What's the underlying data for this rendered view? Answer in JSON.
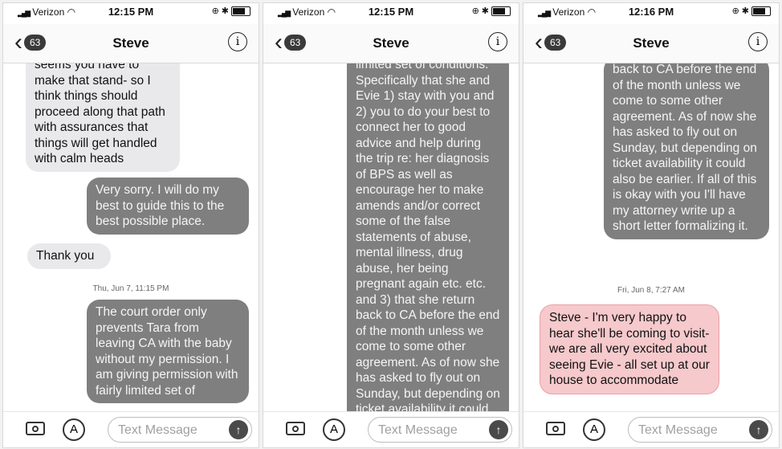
{
  "panels": [
    {
      "status": {
        "carrier": "Verizon",
        "time": "12:15 PM"
      },
      "nav": {
        "badge": "63",
        "title": "Steve"
      },
      "messages": [
        {
          "type": "in",
          "text": "seems you have to make that stand- so I think things should proceed along that path with assurances that things will get handled with calm heads"
        },
        {
          "type": "out",
          "text": "Very sorry. I will do my best to guide this to the best possible place."
        },
        {
          "type": "in",
          "text": "Thank you"
        },
        {
          "type": "stamp",
          "text": "Thu, Jun 7, 11:15 PM"
        },
        {
          "type": "out",
          "text": "The court order only prevents Tara from leaving CA with the baby without my permission. I am giving permission with fairly limited set of"
        }
      ],
      "composer": {
        "placeholder": "Text Message"
      }
    },
    {
      "status": {
        "carrier": "Verizon",
        "time": "12:15 PM"
      },
      "nav": {
        "badge": "63",
        "title": "Steve"
      },
      "messages": [
        {
          "type": "out",
          "text": "limited set of conditions. Specifically that she and Evie 1) stay with you and 2) you to do your best to connect her to good advice and help during the trip re: her diagnosis of BPS as well as encourage her to make amends and/or correct some of the false statements of abuse, mental illness, drug abuse, her being pregnant again etc. etc. and 3) that she return back to CA before the end of the month unless we come to some other agreement. As of now she has asked to fly out on Sunday, but depending on ticket availability it could"
        }
      ],
      "composer": {
        "placeholder": "Text Message"
      }
    },
    {
      "status": {
        "carrier": "Verizon",
        "time": "12:16 PM"
      },
      "nav": {
        "badge": "63",
        "title": "Steve"
      },
      "messages": [
        {
          "type": "out",
          "text": "back to CA before the end of the month unless we come to some other agreement. As of now she has asked to fly out on Sunday, but depending on ticket availability it could also be earlier. If all of this is okay with you I'll have my attorney write up a short letter formalizing it."
        },
        {
          "type": "stamp",
          "text": "Fri, Jun 8, 7:27 AM"
        },
        {
          "type": "in-highlight",
          "text": "Steve - I'm very happy to hear she'll be coming to visit- we are all very excited about seeing Evie - all set up at our house to accommodate"
        }
      ],
      "composer": {
        "placeholder": "Text Message"
      }
    }
  ]
}
